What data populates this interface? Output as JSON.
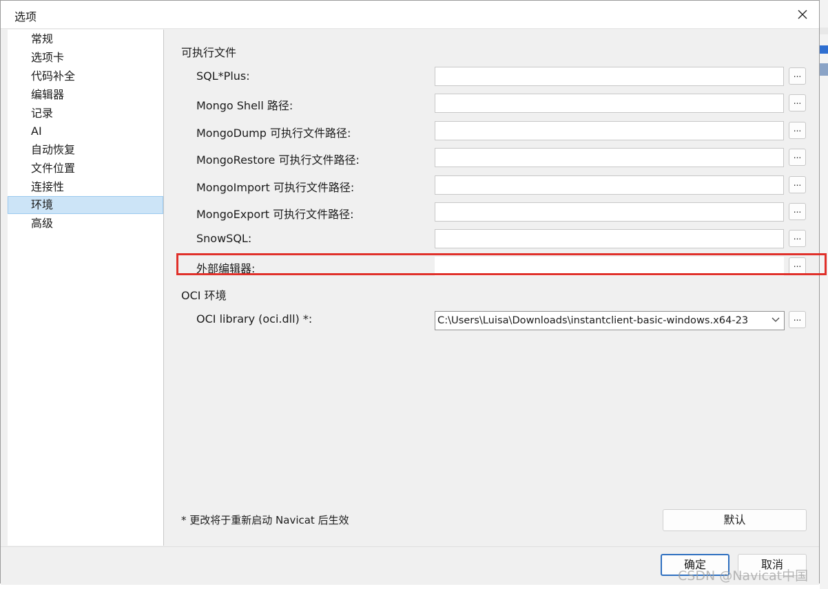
{
  "window": {
    "title": "选项"
  },
  "sidebar": {
    "items": [
      {
        "label": "常规",
        "selected": false
      },
      {
        "label": "选项卡",
        "selected": false
      },
      {
        "label": "代码补全",
        "selected": false
      },
      {
        "label": "编辑器",
        "selected": false
      },
      {
        "label": "记录",
        "selected": false
      },
      {
        "label": "AI",
        "selected": false
      },
      {
        "label": "自动恢复",
        "selected": false
      },
      {
        "label": "文件位置",
        "selected": false
      },
      {
        "label": "连接性",
        "selected": false
      },
      {
        "label": "环境",
        "selected": true
      },
      {
        "label": "高级",
        "selected": false
      }
    ]
  },
  "executables": {
    "section_title": "可执行文件",
    "browse_label": "...",
    "rows": [
      {
        "label": "SQL*Plus:",
        "value": ""
      },
      {
        "label": "Mongo Shell 路径:",
        "value": ""
      },
      {
        "label": "MongoDump 可执行文件路径:",
        "value": ""
      },
      {
        "label": "MongoRestore 可执行文件路径:",
        "value": ""
      },
      {
        "label": "MongoImport 可执行文件路径:",
        "value": ""
      },
      {
        "label": "MongoExport 可执行文件路径:",
        "value": ""
      },
      {
        "label": "SnowSQL:",
        "value": ""
      },
      {
        "label": "外部编辑器:",
        "value": "",
        "highlighted": true
      }
    ]
  },
  "oci": {
    "section_title": "OCI 环境",
    "library_label": "OCI library (oci.dll) *:",
    "library_value": "C:\\Users\\Luisa\\Downloads\\instantclient-basic-windows.x64-23",
    "browse_label": "..."
  },
  "note": "* 更改将于重新启动 Navicat 后生效",
  "buttons": {
    "default": "默认",
    "ok": "确定",
    "cancel": "取消"
  },
  "watermark": "CSDN @Navicat中国",
  "colors": {
    "selection_bg": "#cce4f7",
    "highlight_red": "#e0302a",
    "ok_border": "#2d6fc0"
  },
  "icons": {
    "close": "close-icon",
    "dropdown": "chevron-down-icon"
  }
}
